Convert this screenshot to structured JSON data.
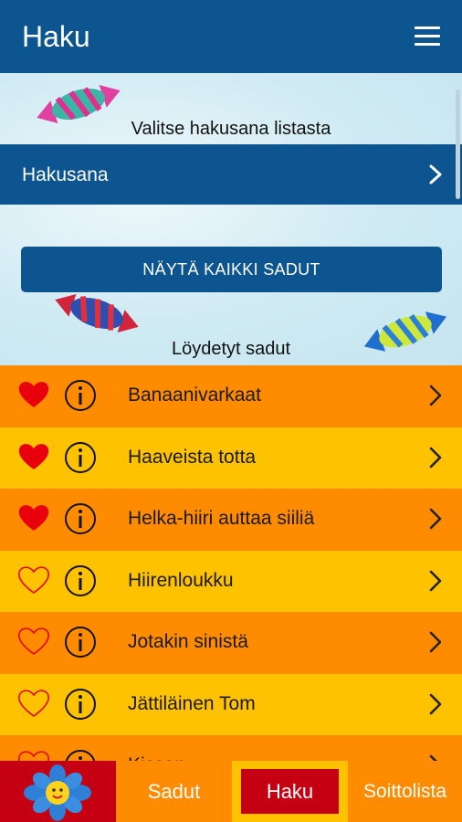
{
  "appbar": {
    "title": "Haku",
    "menu_icon": "hamburger-menu-icon"
  },
  "search": {
    "hint": "Valitse hakusana listasta",
    "field_label": "Hakusana",
    "show_all_label": "NÄYTÄ KAIKKI SADUT",
    "found_label": "Löydetyt sadut"
  },
  "stories": [
    {
      "title": "Banaanivarkaat",
      "favorite": true
    },
    {
      "title": "Haaveista totta",
      "favorite": true
    },
    {
      "title": "Helka-hiiri auttaa siiliä",
      "favorite": true
    },
    {
      "title": "Hiirenloukku",
      "favorite": false
    },
    {
      "title": "Jotakin sinistä",
      "favorite": false
    },
    {
      "title": "Jättiläinen Tom",
      "favorite": false
    },
    {
      "title": "Kissan...",
      "favorite": false
    }
  ],
  "tabs": {
    "home_icon": "flower-sun-icon",
    "sadut": "Sadut",
    "haku": "Haku",
    "soittolista": "Soittolista"
  },
  "colors": {
    "primary": "#0d5590",
    "row_orange": "#ff8c00",
    "row_yellow": "#ffc200",
    "heart_red": "#e8000d",
    "tab_red": "#c40012"
  }
}
